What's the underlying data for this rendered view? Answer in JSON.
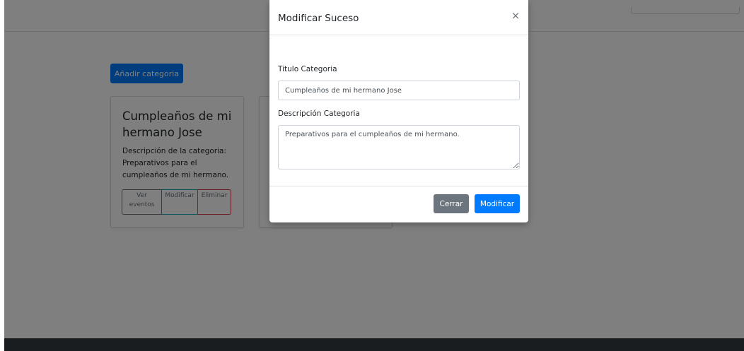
{
  "toolbar": {
    "add_category_label": "Añadir categoria"
  },
  "cards": [
    {
      "title": "Cumpleaños de mi hermano Jose",
      "description": "Descripción de la categoria: Preparativos para el cumpleaños de mi hermano.",
      "buttons": {
        "view_line1": "Ver",
        "view_line2": "eventos",
        "modify": "Modificar",
        "delete": "Eliminar"
      }
    }
  ],
  "modal": {
    "title": "Modificar Suceso",
    "close_glyph": "×",
    "title_field_label": "Titulo Categoria",
    "title_field_value": "Cumpleaños de mi hermano Jose",
    "description_field_label": "Descripción Categoria",
    "description_field_value": "Preparativos para el cumpleaños de mi hermano.",
    "close_button": "Cerrar",
    "modify_button": "Modificar"
  },
  "colors": {
    "primary": "#007bff",
    "secondary": "#6c757d",
    "info": "#17a2b8",
    "danger": "#dc3545",
    "footer": "#343a40",
    "backdrop": "rgba(0,0,0,0.5)"
  }
}
